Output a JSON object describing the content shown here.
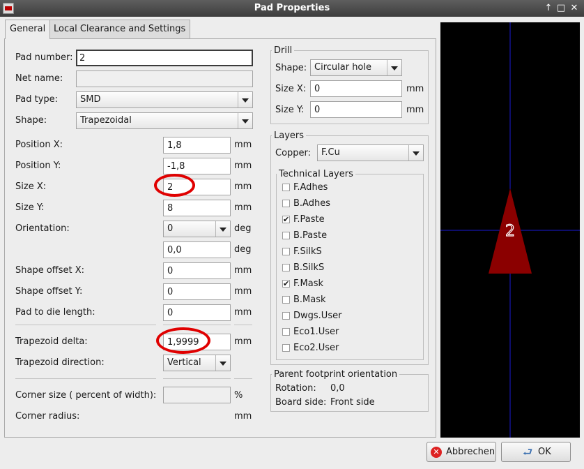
{
  "window": {
    "title": "Pad Properties",
    "buttons": {
      "pin": "↑",
      "maximize": "□",
      "close": "✕"
    }
  },
  "tabs": [
    {
      "label": "General",
      "active": true
    },
    {
      "label": "Local Clearance and Settings",
      "active": false
    }
  ],
  "general": {
    "pad_number": {
      "label": "Pad number:",
      "value": "2"
    },
    "net_name": {
      "label": "Net name:",
      "value": ""
    },
    "pad_type": {
      "label": "Pad type:",
      "value": "SMD"
    },
    "shape": {
      "label": "Shape:",
      "value": "Trapezoidal"
    },
    "position_x": {
      "label": "Position X:",
      "value": "1,8",
      "unit": "mm"
    },
    "position_y": {
      "label": "Position Y:",
      "value": "-1,8",
      "unit": "mm"
    },
    "size_x": {
      "label": "Size X:",
      "value": "2",
      "unit": "mm"
    },
    "size_y": {
      "label": "Size Y:",
      "value": "8",
      "unit": "mm"
    },
    "orientation": {
      "label": "Orientation:",
      "value": "0",
      "unit": "deg"
    },
    "orientation_custom": {
      "value": "0,0",
      "unit": "deg"
    },
    "shape_offset_x": {
      "label": "Shape offset X:",
      "value": "0",
      "unit": "mm"
    },
    "shape_offset_y": {
      "label": "Shape offset Y:",
      "value": "0",
      "unit": "mm"
    },
    "pad_to_die": {
      "label": "Pad to die length:",
      "value": "0",
      "unit": "mm"
    },
    "trapezoid_delta": {
      "label": "Trapezoid delta:",
      "value": "1,9999",
      "unit": "mm"
    },
    "trapezoid_direction": {
      "label": "Trapezoid direction:",
      "value": "Vertical"
    },
    "corner_size": {
      "label": "Corner size ( percent of width):",
      "value": "",
      "unit": "%"
    },
    "corner_radius": {
      "label": "Corner radius:",
      "unit": "mm"
    }
  },
  "drill": {
    "title": "Drill",
    "shape": {
      "label": "Shape:",
      "value": "Circular hole"
    },
    "size_x": {
      "label": "Size X:",
      "value": "0",
      "unit": "mm"
    },
    "size_y": {
      "label": "Size Y:",
      "value": "0",
      "unit": "mm"
    }
  },
  "layers": {
    "title": "Layers",
    "copper": {
      "label": "Copper:",
      "value": "F.Cu"
    },
    "technical_title": "Technical Layers",
    "technical": [
      {
        "label": "F.Adhes",
        "checked": false
      },
      {
        "label": "B.Adhes",
        "checked": false
      },
      {
        "label": "F.Paste",
        "checked": true
      },
      {
        "label": "B.Paste",
        "checked": false
      },
      {
        "label": "F.SilkS",
        "checked": false
      },
      {
        "label": "B.SilkS",
        "checked": false
      },
      {
        "label": "F.Mask",
        "checked": true
      },
      {
        "label": "B.Mask",
        "checked": false
      },
      {
        "label": "Dwgs.User",
        "checked": false
      },
      {
        "label": "Eco1.User",
        "checked": false
      },
      {
        "label": "Eco2.User",
        "checked": false
      }
    ]
  },
  "parent": {
    "title": "Parent footprint orientation",
    "rotation_label": "Rotation:",
    "rotation_value": "0,0",
    "side_label": "Board side:",
    "side_value": "Front side"
  },
  "preview": {
    "pad_label": "2",
    "colors": {
      "background": "#000000",
      "pad": "#8b0000",
      "crosshair": "#1a1ad6"
    }
  },
  "footer": {
    "cancel_label": "Abbrechen",
    "ok_label": "OK"
  },
  "highlight_color": "#e00000"
}
